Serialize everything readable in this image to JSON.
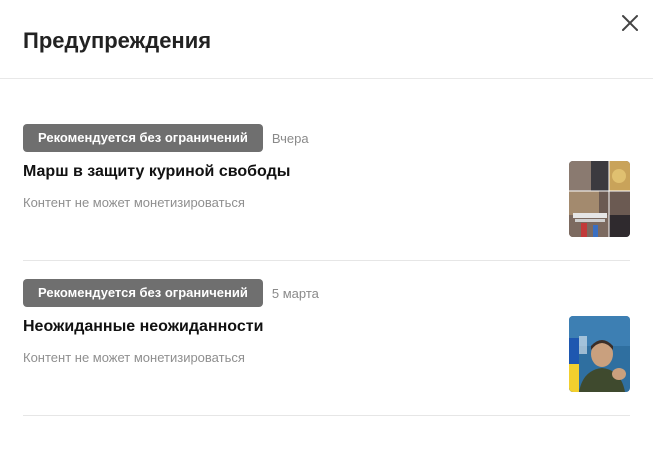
{
  "dialog": {
    "title": "Предупреждения",
    "close_icon": "close-icon"
  },
  "items": [
    {
      "badge": "Рекомендуется без ограничений",
      "date": "Вчера",
      "title": "Марш в защиту куриной свободы",
      "subtitle": "Контент не может монетизироваться",
      "thumbnail": "collage-thumbnail"
    },
    {
      "badge": "Рекомендуется без ограничений",
      "date": "5 марта",
      "title": "Неожиданные неожиданности",
      "subtitle": "Контент не может монетизироваться",
      "thumbnail": "person-thumbnail"
    }
  ],
  "colors": {
    "badge_bg": "#6f6f6f",
    "badge_text": "#ffffff",
    "muted_text": "#8f8f8f",
    "title_text": "#222222"
  }
}
